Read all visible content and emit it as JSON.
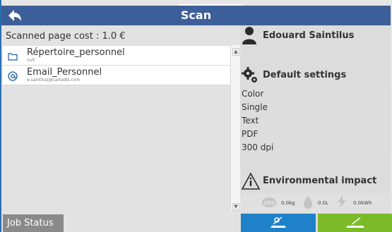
{
  "header": {
    "title": "Scan",
    "back_icon": "back-arrow-icon"
  },
  "left": {
    "cost_text": "Scanned page cost : 1.0 €",
    "items": [
      {
        "title": "Répertoire_personnel",
        "subtitle": "null",
        "icon": "folder-icon"
      },
      {
        "title": "Email_Personnel",
        "subtitle": "e.saintilus@cartadis.com",
        "icon": "at-icon"
      }
    ],
    "job_status_label": "Job Status"
  },
  "right": {
    "user_name": "Edouard Saintilus",
    "settings_title": "Default settings",
    "settings": [
      "Color",
      "Single",
      "Text",
      "PDF",
      "300 dpi"
    ],
    "env_title": "Environmental impact",
    "env_values": {
      "co2": "0.0kg",
      "water": "0.0L",
      "energy": "0.0kWh"
    }
  },
  "colors": {
    "header": "#3d5f99",
    "blue_button": "#1f82c9",
    "green_button": "#7dba2a"
  }
}
